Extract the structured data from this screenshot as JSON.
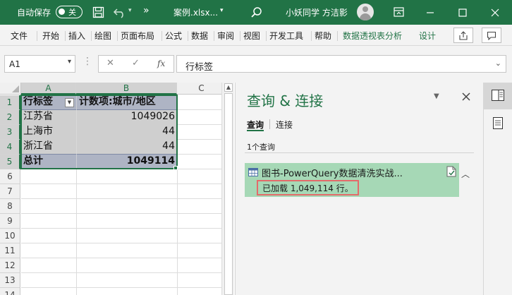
{
  "titlebar": {
    "autosave_label": "自动保存",
    "autosave_state": "关",
    "more_label": "»",
    "filename": "案例.xlsx...",
    "filename_dropdown": "▾",
    "username": "小妖同学 方洁影",
    "accent": "#217346"
  },
  "ribbon": {
    "tabs": [
      {
        "label": "文件"
      },
      {
        "label": "开始"
      },
      {
        "label": "插入"
      },
      {
        "label": "绘图"
      },
      {
        "label": "页面布局"
      },
      {
        "label": "公式"
      },
      {
        "label": "数据"
      },
      {
        "label": "审阅"
      },
      {
        "label": "视图"
      },
      {
        "label": "开发工具"
      },
      {
        "label": "帮助"
      },
      {
        "label": "数据透视表分析"
      },
      {
        "label": "设计"
      }
    ]
  },
  "formula_bar": {
    "name_box": "A1",
    "fx": "fx",
    "cancel_glyph": "✕",
    "enter_glyph": "✓",
    "content": "行标签"
  },
  "grid": {
    "columns": [
      "A",
      "B",
      "C"
    ],
    "rows": [
      "1",
      "2",
      "3",
      "4",
      "5",
      "6",
      "7",
      "8",
      "9",
      "10",
      "11",
      "12",
      "13",
      "14"
    ],
    "pivot": {
      "header": {
        "row_label": "行标签",
        "value_label": "计数项:城市/地区"
      },
      "rows": [
        {
          "label": "江苏省",
          "value": "1049026"
        },
        {
          "label": "上海市",
          "value": "44"
        },
        {
          "label": "浙江省",
          "value": "44"
        }
      ],
      "total": {
        "label": "总计",
        "value": "1049114"
      }
    }
  },
  "query_pane": {
    "title": "查询 & 连接",
    "tabs": [
      {
        "label": "查询",
        "active": true
      },
      {
        "label": "连接",
        "active": false
      }
    ],
    "count_label": "1个查询",
    "queries": [
      {
        "name": "图书-PowerQuery数据清洗实战...",
        "status": "已加载 1,049,114 行。"
      }
    ]
  }
}
